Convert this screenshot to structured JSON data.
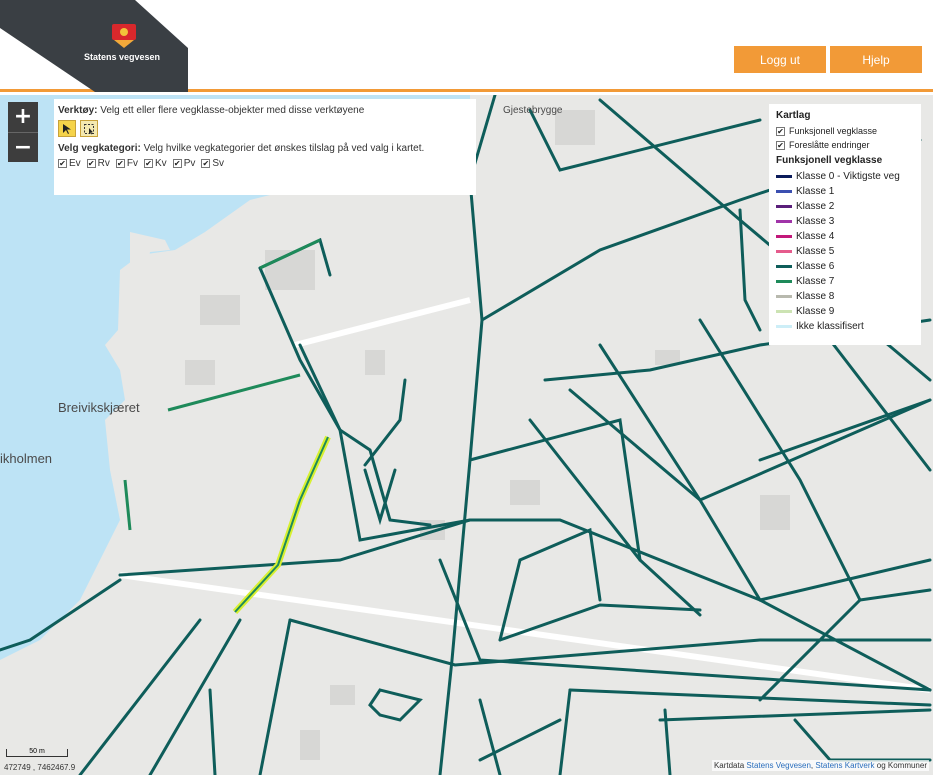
{
  "header": {
    "brand": "Statens vegvesen",
    "logout_label": "Logg ut",
    "help_label": "Hjelp",
    "accent": "#f29a37"
  },
  "tools": {
    "tools_title": "Verktøy:",
    "tools_desc": "Velg ett eller flere vegklasse-objekter med disse verktøyene",
    "category_title": "Velg vegkategori:",
    "category_desc": "Velg hvilke vegkategorier det ønskes tilslag på ved valg i kartet.",
    "categories": [
      "Ev",
      "Rv",
      "Fv",
      "Kv",
      "Pv",
      "Sv"
    ]
  },
  "legend": {
    "title": "Kartlag",
    "layers": [
      "Funksjonell vegklasse",
      "Foreslåtte endringer"
    ],
    "class_title": "Funksjonell vegklasse",
    "classes": [
      {
        "label": "Klasse 0 - Viktigste veg",
        "color": "#0b1b5a"
      },
      {
        "label": "Klasse 1",
        "color": "#3b4fb0"
      },
      {
        "label": "Klasse 2",
        "color": "#5a1f7a"
      },
      {
        "label": "Klasse 3",
        "color": "#a034a8"
      },
      {
        "label": "Klasse 4",
        "color": "#c2187a"
      },
      {
        "label": "Klasse 5",
        "color": "#e55b8c"
      },
      {
        "label": "Klasse 6",
        "color": "#0e5d5a"
      },
      {
        "label": "Klasse 7",
        "color": "#1e8a5a"
      },
      {
        "label": "Klasse 8",
        "color": "#b8b9ae"
      },
      {
        "label": "Klasse 9",
        "color": "#cce3b3"
      },
      {
        "label": "Ikke klassifisert",
        "color": "#cdeef7"
      }
    ]
  },
  "map": {
    "place_labels": [
      "Gjestebrygge",
      "Breivikskjæret",
      "ikholmen"
    ],
    "attribution_prefix": "Kartdata",
    "attribution_link1": "Statens Vegvesen",
    "attribution_link2": "Statens Kartverk",
    "attribution_suffix": "og Kommuner",
    "scale_label": "50 m",
    "coordinates": "472749 , 7462467.9"
  }
}
